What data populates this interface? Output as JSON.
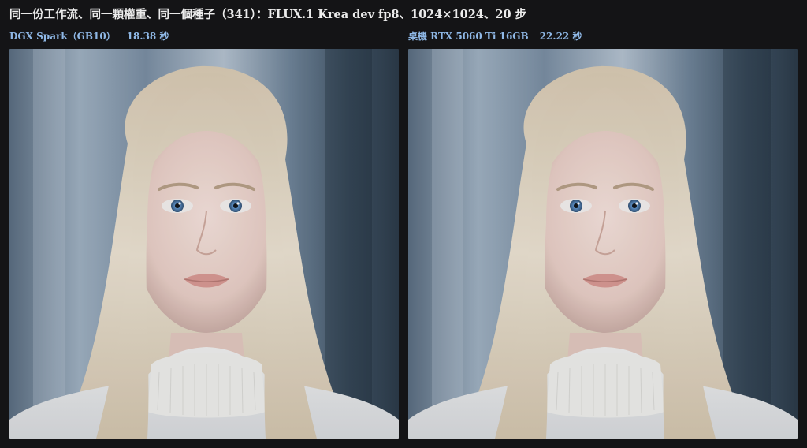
{
  "page": {
    "title": "同一份工作流、同一顆權重、同一個種子（341）：FLUX.1 Krea dev fp8、1024×1024、20 步"
  },
  "panels": [
    {
      "device": "DGX Spark（GB10）",
      "time": "18.38 秒",
      "image": "portrait-photo"
    },
    {
      "device": "桌機 RTX 5060 Ti 16GB",
      "time": "22.22 秒",
      "image": "portrait-photo"
    }
  ],
  "colors": {
    "background": "#141416",
    "title": "#ececec",
    "caption": "#8fb8e6"
  }
}
